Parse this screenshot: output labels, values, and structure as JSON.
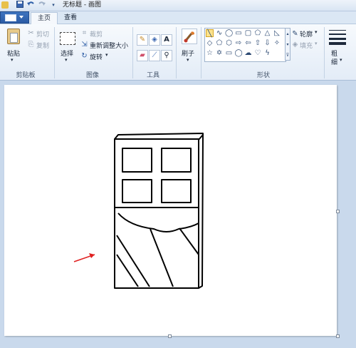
{
  "window": {
    "title": "无标题 - 画图",
    "quick_access": [
      "app-icon",
      "save-icon",
      "undo-icon",
      "redo-icon",
      "customize-icon"
    ]
  },
  "tabs": {
    "file_icon": "menu-icon",
    "home": "主页",
    "view": "查看",
    "active": "主页"
  },
  "ribbon": {
    "clipboard": {
      "group_label": "剪贴板",
      "paste": "粘贴",
      "cut": "剪切",
      "copy": "复制"
    },
    "image": {
      "group_label": "图像",
      "select": "选择",
      "crop": "裁剪",
      "resize": "重新调整大小",
      "rotate": "旋转"
    },
    "tools": {
      "group_label": "工具",
      "items": [
        "pencil-icon",
        "fill-icon",
        "text-icon",
        "eraser-icon",
        "color-picker-icon",
        "magnifier-icon"
      ],
      "text_glyph": "A"
    },
    "brushes": {
      "label": "刷子"
    },
    "shapes": {
      "group_label": "形状",
      "outline": "轮廓",
      "fill": "填充",
      "items": [
        "line",
        "curve",
        "oval",
        "rectangle",
        "rounded-rectangle",
        "polygon",
        "triangle",
        "right-triangle",
        "diamond",
        "pentagon",
        "hexagon",
        "right-arrow",
        "left-arrow",
        "up-arrow",
        "down-arrow",
        "four-point-star",
        "five-point-star",
        "six-point-star",
        "rounded-callout",
        "oval-callout",
        "cloud-callout",
        "heart",
        "lightning"
      ]
    },
    "size": {
      "label_line1": "粗",
      "label_line2": "细"
    }
  },
  "colors": {
    "accent": "#2b5ca5",
    "ribbon": "#e3ecf7",
    "workspace": "#c9d9ec",
    "drawing_arrow": "#e02020"
  }
}
